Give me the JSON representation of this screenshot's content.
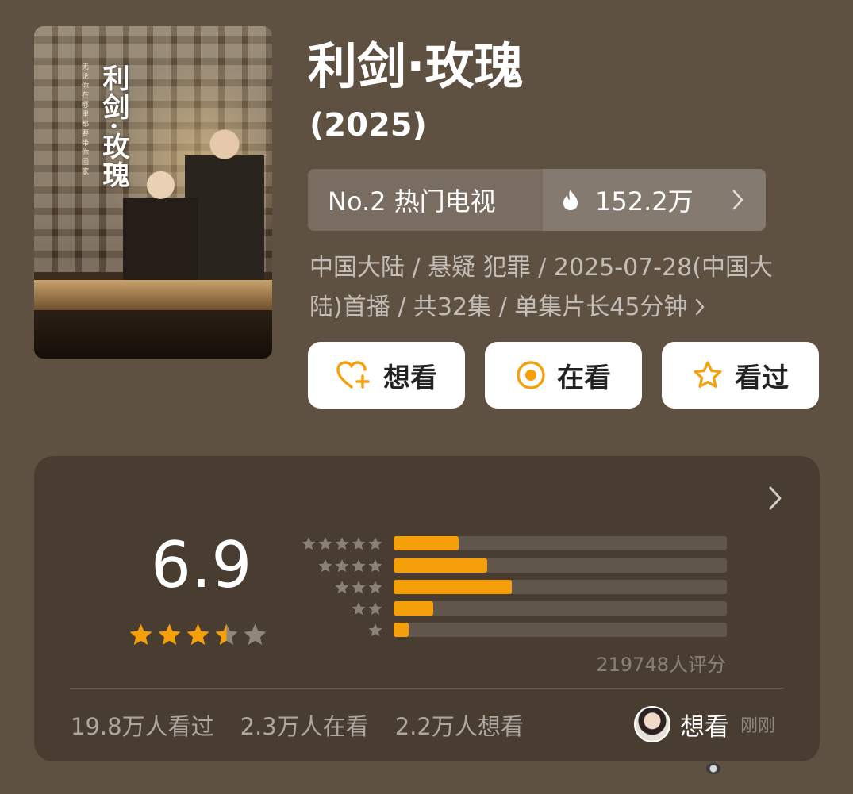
{
  "show": {
    "title": "利剑·玫瑰",
    "year": "(2025)",
    "poster": {
      "title": "利剑·玫瑰",
      "tagline": "无论你在哪里都要带你回家"
    }
  },
  "rank": {
    "label": "No.2 热门电视",
    "heat": "152.2万"
  },
  "meta": {
    "line1": "中国大陆 / 悬疑 犯罪 / 2025-07-28(中国大",
    "line2": "陆)首播 / 共32集 / 单集片长45分钟"
  },
  "actions": {
    "want": "想看",
    "watching": "在看",
    "watched": "看过"
  },
  "rating": {
    "score": "6.9",
    "star_rating_out_of_5": 3.5,
    "distribution": [
      {
        "stars": 5,
        "fraction": 0.195
      },
      {
        "stars": 4,
        "fraction": 0.28
      },
      {
        "stars": 3,
        "fraction": 0.355
      },
      {
        "stars": 2,
        "fraction": 0.12
      },
      {
        "stars": 1,
        "fraction": 0.045
      }
    ],
    "count_text": "219748人评分"
  },
  "stats": {
    "watched": "19.8万人看过",
    "watching": "2.3万人在看",
    "want": "2.2万人想看"
  },
  "friend": {
    "status": "想看",
    "time": "刚刚"
  },
  "colors": {
    "background": "#5f5142",
    "accent_orange": "#f5a00b",
    "star_gray": "#8f867c"
  }
}
